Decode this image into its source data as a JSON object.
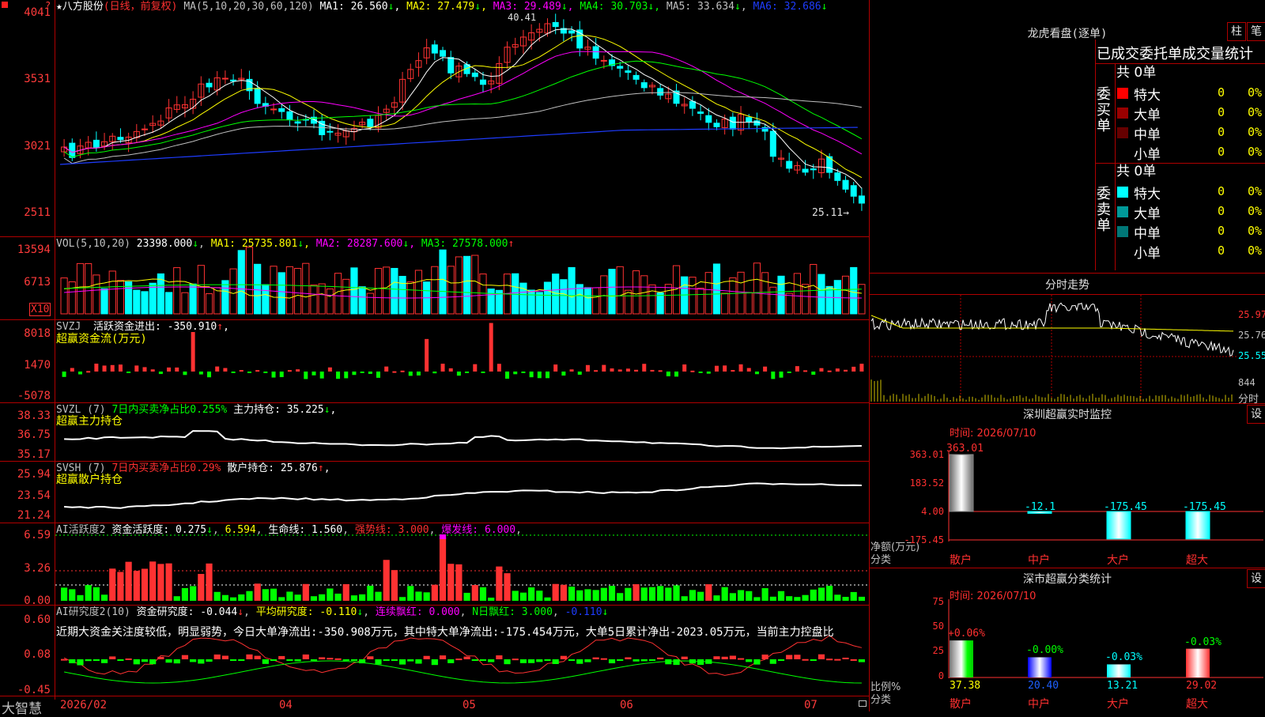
{
  "colors": {
    "up": "#ff3232",
    "down": "#00ffff",
    "ma1": "#ffffff",
    "ma2": "#ffff00",
    "ma3": "#ff00ff",
    "ma4": "#00ff00",
    "ma5": "#c0c0c0",
    "ma6": "#1e3cff",
    "green": "#00ff00",
    "yellow": "#ffff00",
    "magenta": "#ff00ff",
    "grid": "#b00000"
  },
  "main": {
    "star": "★",
    "stock": "八方股份",
    "mode": "(日线，前复权)",
    "ma_title": "MA(5,10,20,30,60,120)",
    "ma": [
      {
        "k": "MA1:",
        "v": "26.560",
        "a": "↓"
      },
      {
        "k": "MA2:",
        "v": "27.479",
        "a": "↓"
      },
      {
        "k": "MA3:",
        "v": "29.489",
        "a": "↓"
      },
      {
        "k": "MA4:",
        "v": "30.703",
        "a": "↓"
      },
      {
        "k": "MA5:",
        "v": "33.634",
        "a": "↓"
      },
      {
        "k": "MA6:",
        "v": "32.686",
        "a": "↓"
      }
    ],
    "axis": [
      "4041",
      "3531",
      "3021",
      "2511"
    ],
    "high_label": "40.41",
    "low_label": "25.11→"
  },
  "vol": {
    "title": "VOL(5,10,20)",
    "value": "23398.000",
    "a": "↓",
    "ma": [
      {
        "k": "MA1:",
        "v": "25735.801",
        "a": "↓"
      },
      {
        "k": "MA2:",
        "v": "28287.600",
        "a": "↓"
      },
      {
        "k": "MA3:",
        "v": "27578.000",
        "a": "↑"
      }
    ],
    "axis": [
      "13594",
      "6713"
    ],
    "unit": "X10"
  },
  "svzj": {
    "title": "SVZJ",
    "label": "活跃资金进出:",
    "value": "-350.910",
    "a": "↑",
    "comma": ",",
    "sub": "超赢资金流(万元)",
    "axis": [
      "8018",
      "1470",
      "-5078"
    ]
  },
  "svzl": {
    "title": "SVZL (7)",
    "desc": "7日内买卖净占比0.255%",
    "label": "主力持仓:",
    "value": "35.225",
    "a": "↓",
    "comma": ",",
    "sub": "超赢主力持仓",
    "axis": [
      "38.33",
      "36.75",
      "35.17"
    ]
  },
  "svsh": {
    "title": "SVSH (7)",
    "desc": "7日内买卖净占比0.29%",
    "label": "散户持仓:",
    "value": "25.876",
    "a": "↑",
    "comma": ",",
    "sub": "超赢散户持仓",
    "axis": [
      "25.94",
      "23.54",
      "21.24"
    ]
  },
  "ai1": {
    "title": "AI活跃度2",
    "label": "资金活跃度:",
    "value": "0.275",
    "a": "↓",
    "v2": "6.594",
    "label3": "生命线:",
    "value3": "1.560",
    "qs": "强势线: 3.000",
    "bf": "爆发线: 6.000",
    "axis": [
      "6.59",
      "3.26",
      "0.00"
    ]
  },
  "ai2": {
    "title": "AI研究度2(10)",
    "label": "资金研究度:",
    "value": "-0.044",
    "a": "↓",
    "avg": "平均研究度: -0.110",
    "avg_a": "↓",
    "lx": "连续飘红: 0.000",
    "n": "N日飘红: 3.000",
    "n2": "-0.110",
    "n2_a": "↓",
    "desc": "近期大资金关注度较低，明显弱势，今日大单净流出:-350.908万元，其中特大单净流出:-175.454万元，大单5日累计净出-2023.05万元，当前主力控盘比",
    "axis": [
      "0.60",
      "0.08",
      "-0.45"
    ]
  },
  "bottom": {
    "brand": "大智慧",
    "dates": [
      "2026/02",
      "04",
      "05",
      "06",
      "07"
    ]
  },
  "lhb": {
    "title": "龙虎看盘(逐单)",
    "btn1": "柱",
    "btn2": "笔",
    "sub": "已成交委托单成交量统计",
    "buy": {
      "side": "委买单",
      "total": "共 0单",
      "rows": [
        {
          "n": "特大",
          "v": "0",
          "p": "0%",
          "c": "#ff0000"
        },
        {
          "n": "大单",
          "v": "0",
          "p": "0%",
          "c": "#990000"
        },
        {
          "n": "中单",
          "v": "0",
          "p": "0%",
          "c": "#660000"
        },
        {
          "n": "小单",
          "v": "0",
          "p": "0%",
          "c": ""
        }
      ]
    },
    "sell": {
      "side": "委卖单",
      "total": "共 0单",
      "rows": [
        {
          "n": "特大",
          "v": "0",
          "p": "0%",
          "c": "#00ffff"
        },
        {
          "n": "大单",
          "v": "0",
          "p": "0%",
          "c": "#009999"
        },
        {
          "n": "中单",
          "v": "0",
          "p": "0%",
          "c": "#007777"
        },
        {
          "n": "小单",
          "v": "0",
          "p": "0%",
          "c": ""
        }
      ]
    }
  },
  "fs": {
    "title": "分时走势",
    "axis": [
      "25.97",
      "25.76",
      "25.55"
    ],
    "vol": "844",
    "lbl": "分时"
  },
  "sz": {
    "title": "深圳超赢实时监控",
    "btn": "设",
    "time": "时间: 2026/07/10",
    "axis": [
      "363.01",
      "183.52",
      "4.00",
      "-175.45"
    ],
    "ylabel": "净额(万元)",
    "xlabel": "分类",
    "bars": [
      {
        "cat": "散户",
        "label": "363.01",
        "val": 363.01
      },
      {
        "cat": "中户",
        "label": "-12.1",
        "val": -12.1
      },
      {
        "cat": "大户",
        "label": "-175.45",
        "val": -175.45
      },
      {
        "cat": "超大",
        "label": "-175.45",
        "val": -175.45
      }
    ]
  },
  "fl": {
    "title": "深市超赢分类统计",
    "btn": "设",
    "time": "时间: 2026/07/10",
    "axis": [
      "75",
      "50",
      "25",
      "0"
    ],
    "ylabel": "比例%",
    "xlabel": "分类",
    "bars": [
      {
        "cat": "散户",
        "pct": "+0.06%",
        "val": "37.38",
        "v": 37.38
      },
      {
        "cat": "中户",
        "pct": "-0.00%",
        "val": "20.40",
        "v": 20.4
      },
      {
        "cat": "大户",
        "pct": "-0.03%",
        "val": "13.21",
        "v": 13.21
      },
      {
        "cat": "超大",
        "pct": "-0.03%",
        "val": "29.02",
        "v": 29.02
      }
    ]
  }
}
